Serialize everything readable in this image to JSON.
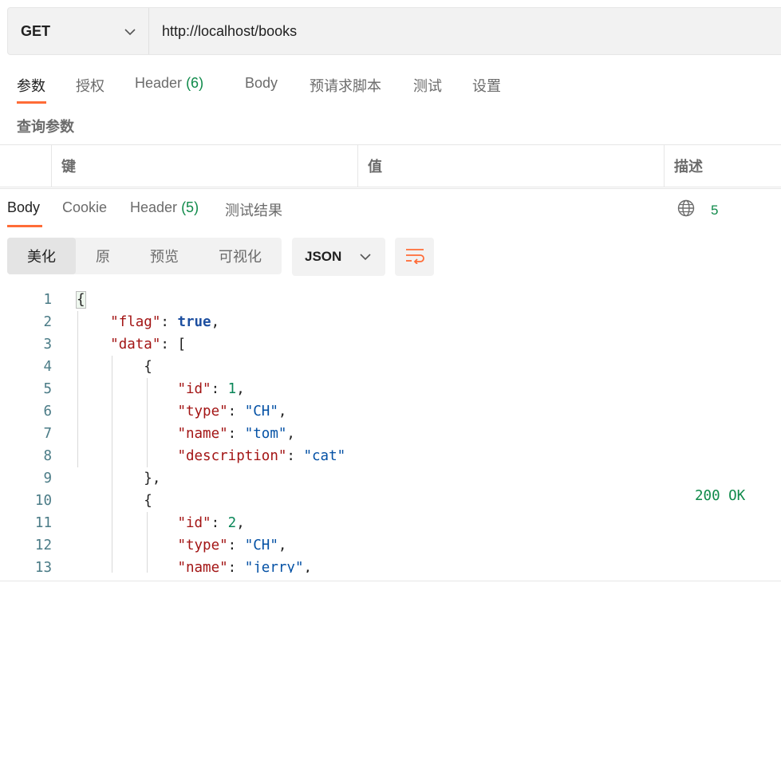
{
  "request": {
    "method": "GET",
    "url": "http://localhost/books"
  },
  "request_tabs": [
    {
      "label": "参数",
      "active": true
    },
    {
      "label": "授权"
    },
    {
      "label": "Header",
      "count": "(6)"
    },
    {
      "label": "Body"
    },
    {
      "label": "预请求脚本"
    },
    {
      "label": "测试"
    },
    {
      "label": "设置"
    }
  ],
  "query_params": {
    "title": "查询参数",
    "columns": [
      "键",
      "值",
      "描述"
    ]
  },
  "response_tabs": [
    {
      "label": "Body",
      "active": true
    },
    {
      "label": "Cookie"
    },
    {
      "label": "Header",
      "count": "(5)"
    },
    {
      "label": "测试结果"
    }
  ],
  "status": {
    "icon": "globe-icon",
    "code": "200 OK",
    "truncated": "5"
  },
  "view_modes": [
    "美化",
    "原",
    "预览",
    "可视化"
  ],
  "active_view_mode": "美化",
  "format": "JSON",
  "wrap_icon": "wrap-lines-icon",
  "accent_color": "#ff6c37",
  "success_color": "#0f8a4a",
  "code_lines": [
    {
      "n": "1",
      "t": "{"
    },
    {
      "n": "2",
      "t": "    \"flag\": true,"
    },
    {
      "n": "3",
      "t": "    \"data\": ["
    },
    {
      "n": "4",
      "t": "        {"
    },
    {
      "n": "5",
      "t": "            \"id\": 1,"
    },
    {
      "n": "6",
      "t": "            \"type\": \"CH\","
    },
    {
      "n": "7",
      "t": "            \"name\": \"tom\","
    },
    {
      "n": "8",
      "t": "            \"description\": \"cat\""
    },
    {
      "n": "9",
      "t": "        },"
    },
    {
      "n": "10",
      "t": "        {"
    },
    {
      "n": "11",
      "t": "            \"id\": 2,"
    },
    {
      "n": "12",
      "t": "            \"type\": \"CH\","
    },
    {
      "n": "13",
      "t": "            \"name\": \"jerry\","
    }
  ]
}
